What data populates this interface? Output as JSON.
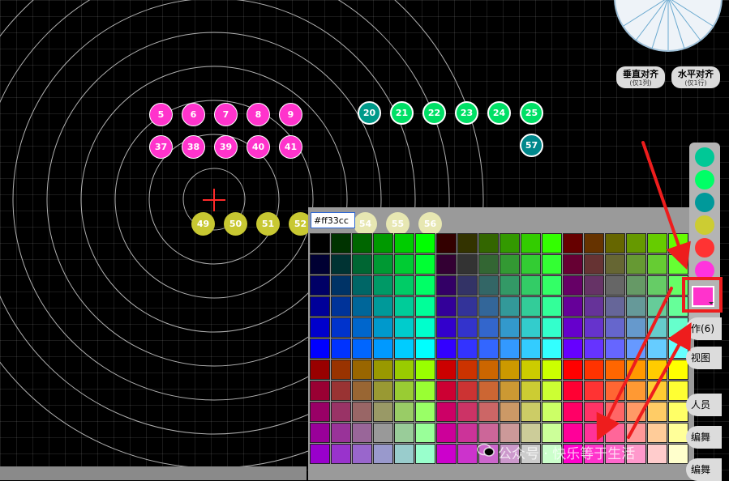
{
  "seats": {
    "row1": [
      {
        "label": "5"
      },
      {
        "label": "6"
      },
      {
        "label": "7"
      },
      {
        "label": "8"
      },
      {
        "label": "9"
      }
    ],
    "row2": [
      {
        "label": "37"
      },
      {
        "label": "38"
      },
      {
        "label": "39"
      },
      {
        "label": "40"
      },
      {
        "label": "41"
      }
    ],
    "row3": [
      {
        "label": "20"
      },
      {
        "label": "21"
      },
      {
        "label": "22"
      },
      {
        "label": "23"
      },
      {
        "label": "24"
      },
      {
        "label": "25"
      }
    ],
    "row4": [
      {
        "label": "57"
      }
    ],
    "row5": [
      {
        "label": "49"
      },
      {
        "label": "50"
      },
      {
        "label": "51"
      },
      {
        "label": "52"
      },
      {
        "label": "54"
      },
      {
        "label": "55"
      },
      {
        "label": "56"
      }
    ]
  },
  "buttons": {
    "vertical_align": {
      "main": "垂直对齐",
      "sub": "(仅1列)"
    },
    "horizontal_align": {
      "main": "水平对齐",
      "sub": "(仅1行)"
    }
  },
  "swatches": [
    "#00c896",
    "#00ff66",
    "#00999a",
    "#cccc33",
    "#ff3333",
    "#ff33dd"
  ],
  "current_color": "#ff33cc",
  "color_picker": {
    "hex_value": "#ff33cc"
  },
  "right_buttons": [
    "作(6)",
    "视图",
    "人员",
    "编舞",
    "编舞"
  ],
  "watermark": "公众号 · 快乐等于生活",
  "colors": {
    "accent_red": "#ee1d1d",
    "pink": "#ff33cc"
  }
}
